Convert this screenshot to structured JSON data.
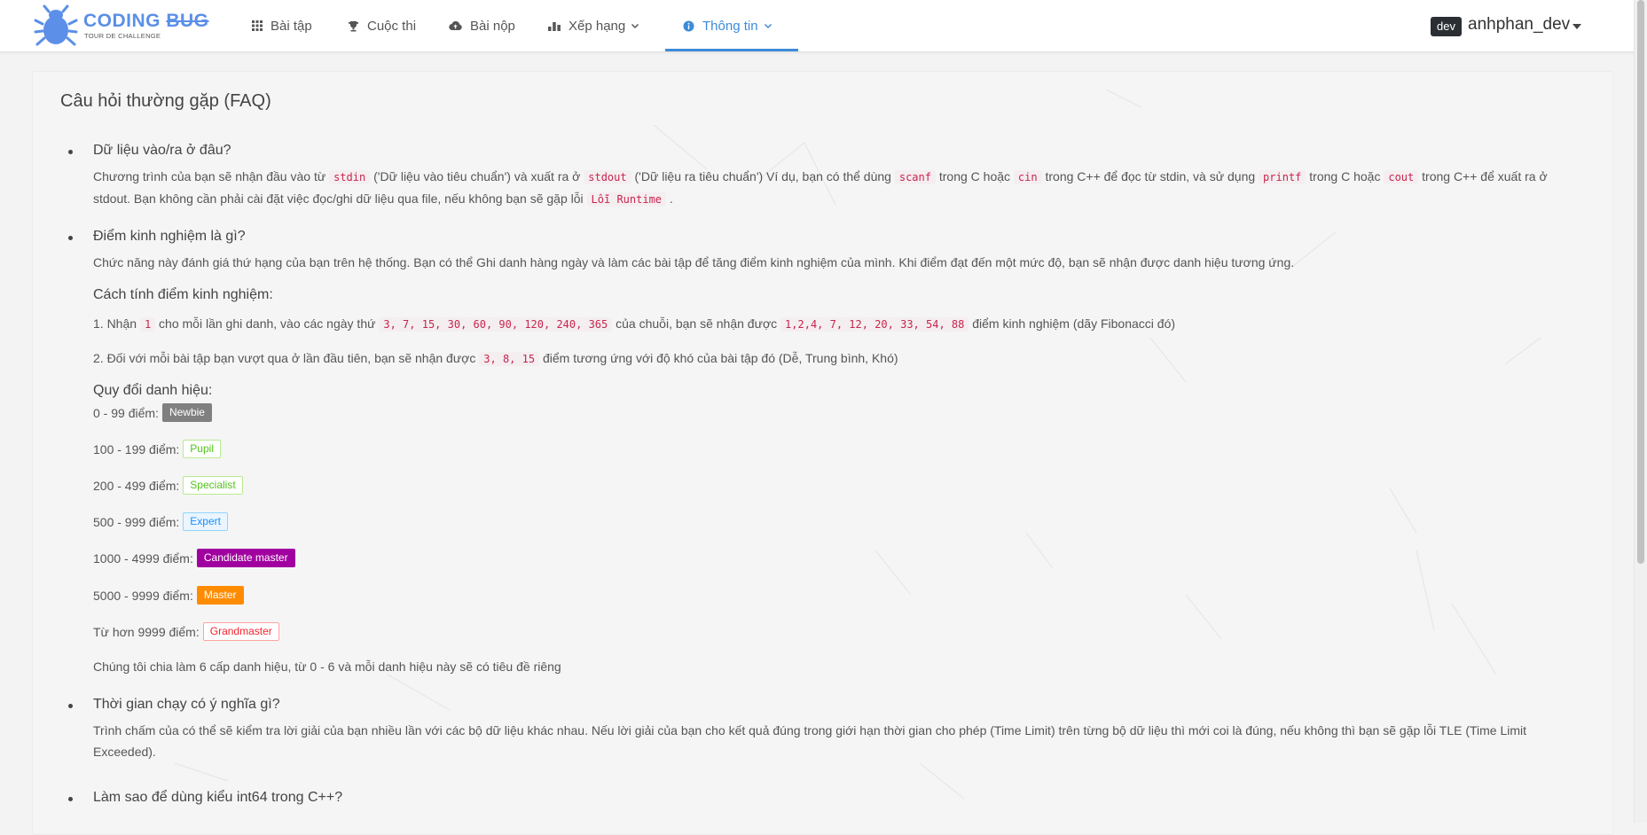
{
  "navbar": {
    "logo_title_a": "CODING ",
    "logo_title_b": "BUG",
    "logo_subtitle": "TOUR DE CHALLENGE",
    "items": [
      {
        "label": "Bài tập",
        "icon": "grid-icon"
      },
      {
        "label": "Cuộc thi",
        "icon": "trophy-icon"
      },
      {
        "label": "Bài nộp",
        "icon": "cloud-upload-icon"
      },
      {
        "label": "Xếp hạng",
        "icon": "bar-chart-icon"
      },
      {
        "label": "Thông tin",
        "icon": "info-icon"
      }
    ],
    "active_item": "Thông tin",
    "user_badge": "dev",
    "username": "anhphan_dev",
    "accent_color": "#3d8bd9"
  },
  "page": {
    "title": "Câu hỏi thường gặp (FAQ)",
    "faq": {
      "q1": {
        "question": "Dữ liệu vào/ra ở đâu?",
        "t1": "Chương trình của bạn sẽ nhận đầu vào từ ",
        "c1": "stdin",
        "t2": " ('Dữ liệu vào tiêu chuẩn') và xuất ra ở ",
        "c2": "stdout",
        "t3": " ('Dữ liệu ra tiêu chuẩn') Ví dụ, bạn có thể dùng ",
        "c3": "scanf",
        "t4": " trong C hoặc ",
        "c4": "cin",
        "t5": " trong C++ để đọc từ stdin, và sử dụng ",
        "c5": "printf",
        "t6": " trong C hoặc ",
        "c6": "cout",
        "t7": " trong C++ để xuất ra ở stdout. Bạn không cần phải cài đặt việc đọc/ghi dữ liệu qua file, nếu không bạn sẽ gặp lỗi ",
        "c7": "Lỗi Runtime",
        "t8": " ."
      },
      "q2": {
        "question": "Điểm kinh nghiệm là gì?",
        "answer": "Chức năng này đánh giá thứ hạng của bạn trên hệ thống. Bạn có thể Ghi danh hàng ngày và làm các bài tập để tăng điểm kinh nghiệm của mình. Khi điểm đạt đến một mức độ, bạn sẽ nhận được danh hiệu tương ứng.",
        "calc_heading": "Cách tính điểm kinh nghiệm:",
        "r1_a": "1. Nhận ",
        "r1_c1": "1",
        "r1_b": " cho mỗi lần ghi danh, vào các ngày thứ ",
        "r1_c2": "3, 7, 15, 30, 60, 90, 120, 240, 365",
        "r1_c": " của chuỗi, bạn sẽ nhận được ",
        "r1_c3": "1,2,4, 7, 12, 20, 33, 54, 88",
        "r1_d": " điểm kinh nghiệm  (dãy Fibonacci đó)",
        "r2_a": "2. Đối với mỗi bài tập bạn vượt qua ở lần đầu tiên, bạn sẽ nhận được ",
        "r2_c1": "3, 8, 15",
        "r2_b": " điểm tương ứng với độ khó của bài tập đó (Dễ, Trung bình, Khó)",
        "convert_heading": "Quy đổi danh hiệu:",
        "ranks": [
          {
            "range": "0 - 99 điểm:",
            "title": "Newbie",
            "color": "#808080"
          },
          {
            "range": "100 - 199 điểm:",
            "title": "Pupil",
            "color": "#52c41a"
          },
          {
            "range": "200 - 499 điểm:",
            "title": "Specialist",
            "color": "#52c41a"
          },
          {
            "range": "500 - 999 điểm:",
            "title": "Expert",
            "color": "#1890ff"
          },
          {
            "range": "1000 - 4999 điểm:",
            "title": "Candidate master",
            "color": "#a0009f"
          },
          {
            "range": "5000 - 9999 điểm:",
            "title": "Master",
            "color": "#ff8c00"
          },
          {
            "range": "Từ hơn 9999 điểm:",
            "title": "Grandmaster",
            "color": "#f5222d"
          }
        ],
        "note": "Chúng tôi chia làm 6 cấp danh hiệu, từ 0 - 6 và mỗi danh hiệu này sẽ có tiêu đề riêng"
      },
      "q3": {
        "question": "Thời gian chạy có ý nghĩa gì?",
        "answer": "Trình chấm của có thể sẽ kiểm tra lời giải của bạn nhiều lần với các bộ dữ liệu khác nhau. Nếu lời giải của bạn cho kết quả đúng trong giới hạn thời gian cho phép (Time Limit) trên từng bộ dữ liệu thì mới coi là đúng, nếu không thì bạn sẽ gặp lỗi TLE (Time Limit Exceeded)."
      },
      "q4": {
        "question": "Làm sao để dùng kiểu int64 trong C++?"
      }
    }
  }
}
